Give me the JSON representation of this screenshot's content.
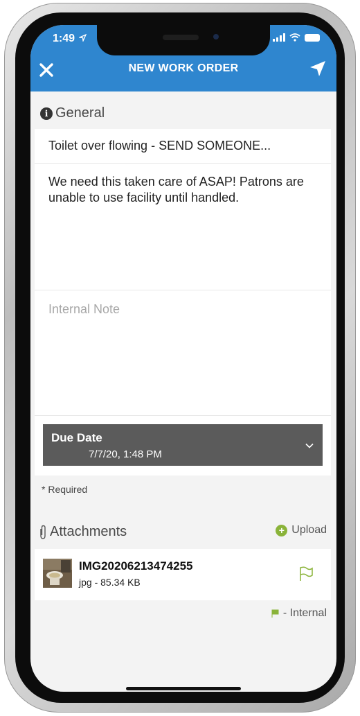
{
  "status": {
    "time": "1:49"
  },
  "header": {
    "title": "NEW WORK ORDER"
  },
  "general": {
    "section_label": "General",
    "subject": "Toilet over flowing - SEND SOMEONE...",
    "description": "We need this taken care of ASAP! Patrons are unable to use facility until handled.",
    "internal_note_placeholder": "Internal Note",
    "due_date_label": "Due Date",
    "due_date_value": "7/7/20, 1:48 PM"
  },
  "required_note": "* Required",
  "attachments": {
    "section_label": "Attachments",
    "upload_label": "Upload",
    "items": [
      {
        "name": "IMG20206213474255",
        "meta": "jpg - 85.34 KB"
      }
    ],
    "legend_label": "- Internal"
  },
  "colors": {
    "header_blue": "#2f86cf",
    "due_date_bg": "#5b5b5b",
    "accent_green": "#8ab339"
  }
}
